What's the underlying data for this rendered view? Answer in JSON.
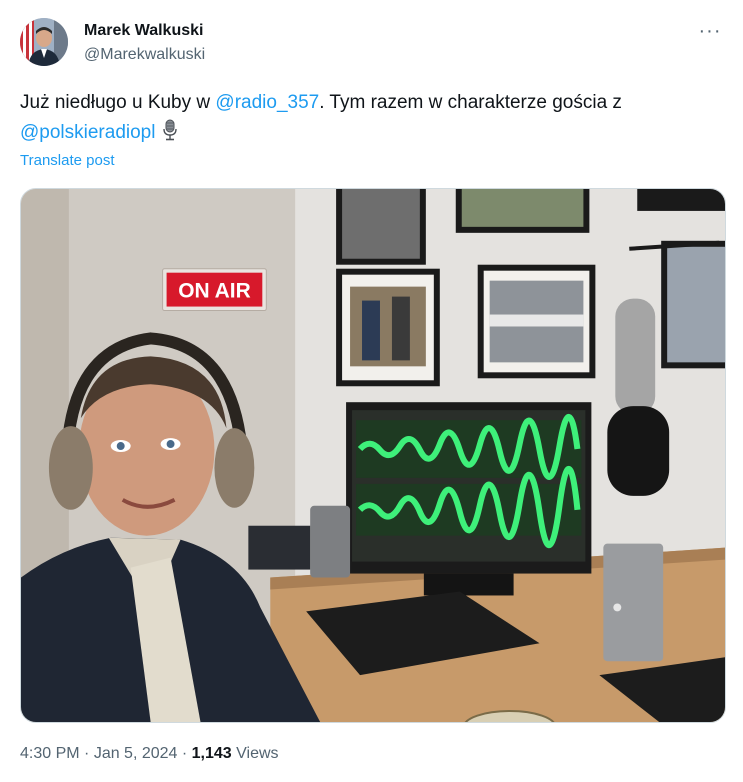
{
  "author": {
    "name": "Marek Walkuski",
    "handle": "@Marekwalkuski"
  },
  "post": {
    "text_part1": "Już niedługo u Kuby w ",
    "mention1": "@radio_357",
    "text_part2": ". Tym razem w charakterze gościa z ",
    "mention2": "@polskieradiopl",
    "mic_emoji_icon": "microphone-icon"
  },
  "translate_label": "Translate post",
  "image": {
    "sign_text": "ON AIR"
  },
  "meta": {
    "time": "4:30 PM",
    "sep1": " · ",
    "date": "Jan 5, 2024",
    "sep2": " · ",
    "views_count": "1,143",
    "views_label": " Views"
  },
  "colors": {
    "link": "#1d9bf0",
    "secondary_text": "#536471",
    "on_air_red": "#d7192b"
  }
}
